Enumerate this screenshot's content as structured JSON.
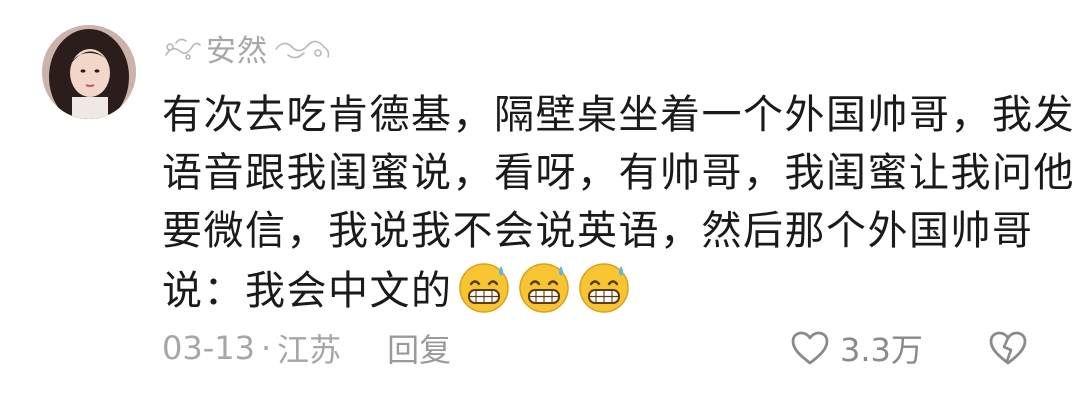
{
  "comment": {
    "username": "安然",
    "lines": [
      "有次去吃肯德基，隔壁桌坐着一个外国帅哥，我发",
      "语音跟我闺蜜说，看呀，有帅哥，我闺蜜让我问他",
      "要微信，我说我不会说英语，然后那个外国帅哥",
      "说：我会中文的"
    ],
    "emojis": [
      "grin-sweat-emoji",
      "grin-sweat-emoji",
      "grin-sweat-emoji"
    ],
    "date": "03-13",
    "separator": "·",
    "location": "江苏",
    "reply_label": "回复",
    "like_count": "3.3万"
  },
  "colors": {
    "text": "#1a1a1a",
    "meta": "#a6a6a6",
    "emoji_face": "#f7c531"
  }
}
